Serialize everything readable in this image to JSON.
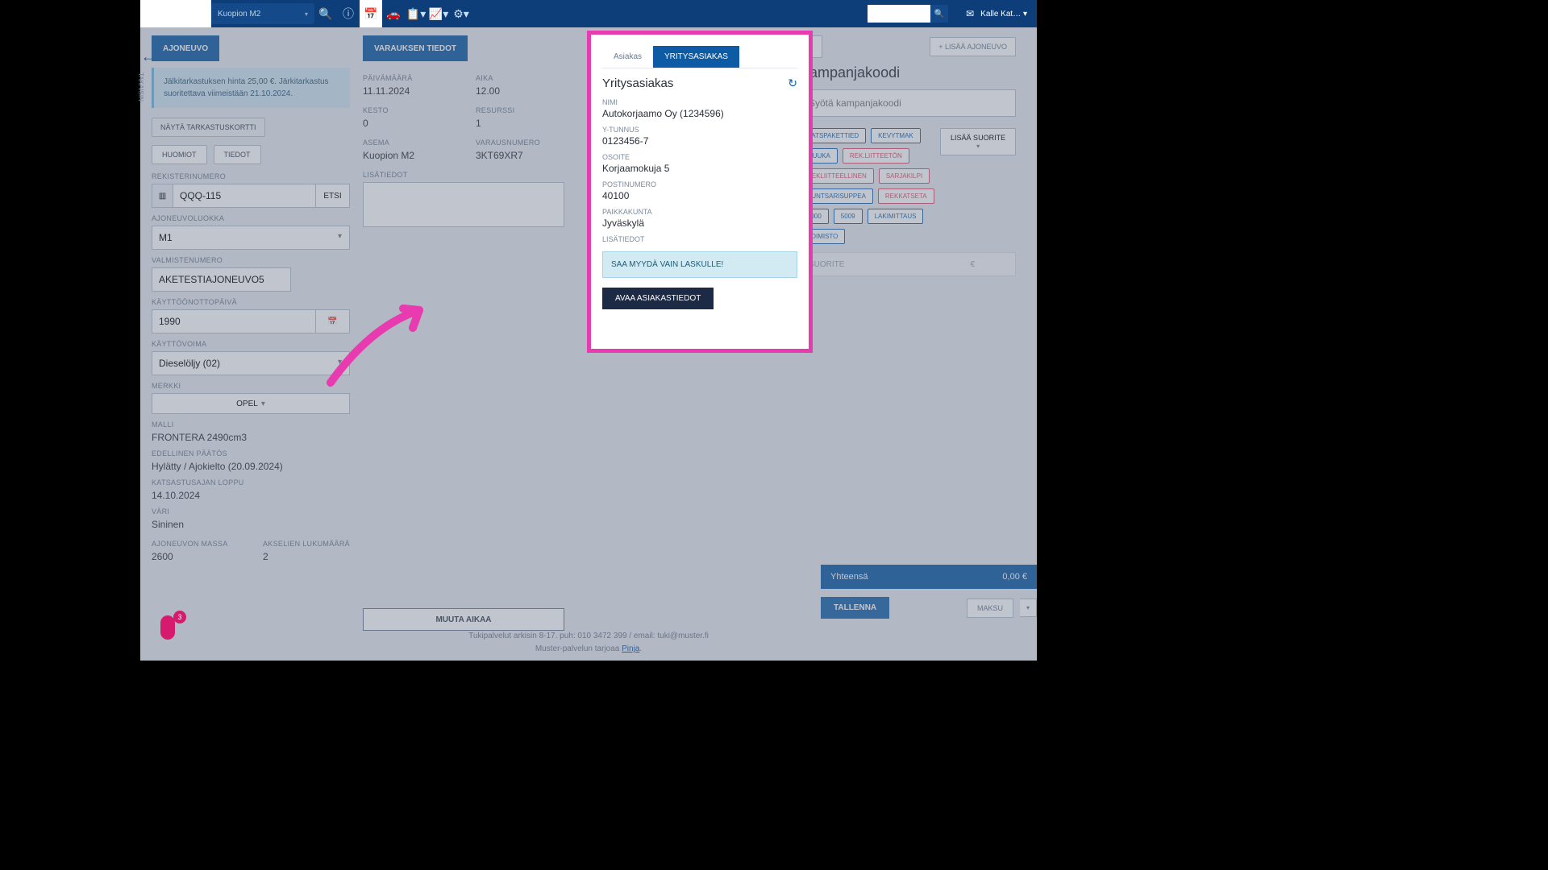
{
  "topbar": {
    "location": "Kuopion M2",
    "user": "Kalle Kat…"
  },
  "sidebar_back": "TAKAISIN",
  "notification_badge": "3",
  "vehicle": {
    "tab": "AJONEUVO",
    "info_notice": "Jälkitarkastuksen hinta 25,00 €. Järkitarkastus suoritettava viimeistään 21.10.2024.",
    "btn_kortti": "NÄYTÄ TARKASTUSKORTTI",
    "btn_huomiot": "HUOMIOT",
    "btn_tiedot": "TIEDOT",
    "labels": {
      "rek": "REKISTERINUMERO",
      "luokka": "AJONEUVOLUOKKA",
      "valm": "VALMISTENUMERO",
      "kayttoon": "KÄYTTÖÖNOTTOPÄIVÄ",
      "voima": "KÄYTTÖVOIMA",
      "merkki": "MERKKI",
      "malli": "MALLI",
      "edpaatos": "EDELLINEN PÄÄTÖS",
      "katsloppu": "KATSASTUSAJAN LOPPU",
      "vari": "VÄRI",
      "massa": "AJONEUVON MASSA",
      "akselit": "AKSELIEN LUKUMÄÄRÄ"
    },
    "rek": "QQQ-115",
    "etsi": "ETSI",
    "luokka": "M1",
    "valm": "AKETESTIAJONEUVO5",
    "kayttoon": "1990",
    "voima": "Dieselöljy (02)",
    "merkki": "OPEL",
    "malli": "FRONTERA 2490cm3",
    "edpaatos": "Hylätty / Ajokielto (20.09.2024)",
    "katsloppu": "14.10.2024",
    "vari": "Sininen",
    "massa": "2600",
    "akselit": "2"
  },
  "booking": {
    "tab": "VARAUKSEN TIEDOT",
    "labels": {
      "pvm": "PÄIVÄMÄÄRÄ",
      "aika": "AIKA",
      "kesto": "KESTO",
      "res": "RESURSSI",
      "asema": "ASEMA",
      "varno": "VARAUSNUMERO",
      "lisa": "LISÄTIEDOT"
    },
    "pvm": "11.11.2024",
    "aika": "12.00",
    "kesto": "0",
    "res": "1",
    "asema": "Kuopion M2",
    "varno": "3KT69XR7",
    "muuta": "MUUTA AIKAA"
  },
  "customer": {
    "tab_asiakas": "Asiakas",
    "tab_yritys": "YRITYSASIAKAS",
    "heading": "Yritysasiakas",
    "labels": {
      "nimi": "NIMI",
      "ytunnus": "Y-TUNNUS",
      "osoite": "OSOITE",
      "postino": "POSTINUMERO",
      "paikka": "PAIKKAKUNTA",
      "lisa": "LISÄTIEDOT"
    },
    "nimi": "Autokorjaamo Oy (1234596)",
    "ytunnus": "0123456-7",
    "osoite": "Korjaamokuja 5",
    "postino": "40100",
    "paikka": "Jyväskylä",
    "notice": "SAA MYYDÄ VAIN LASKULLE!",
    "avaa": "AVAA ASIAKASTIEDOT"
  },
  "campaign": {
    "heading": "Kampanjakoodi",
    "placeholder": "Syötä kampanjakoodi",
    "lisaa_ajoneuvo": "+ LISÄÄ AJONEUVO",
    "lisaa_suorite": "LISÄÄ SUORITE",
    "chips": [
      "KATSPAKETTIED",
      "KEVYTMAK",
      "MUUKA",
      "REK.LIITTEETÖN",
      "REKLIITTEELLINEN",
      "SARJAKILPI",
      "KUNTSARISUPPEA",
      "REKKATSETA",
      "5000",
      "5009",
      "LAKIMITTAUS",
      "TOIMISTO"
    ],
    "suorite": "SUORITE",
    "euro": "€"
  },
  "totals": {
    "yhteensa": "Yhteensä",
    "amount": "0,00 €",
    "tallenna": "TALLENNA",
    "maksu": "MAKSU"
  },
  "footer": {
    "line1": "Tukipalvelut arkisin 8-17. puh: 010 3472 399 / email: tuki@muster.fi",
    "line2": "Muster-palvelun tarjoaa ",
    "link": "Pinja"
  }
}
